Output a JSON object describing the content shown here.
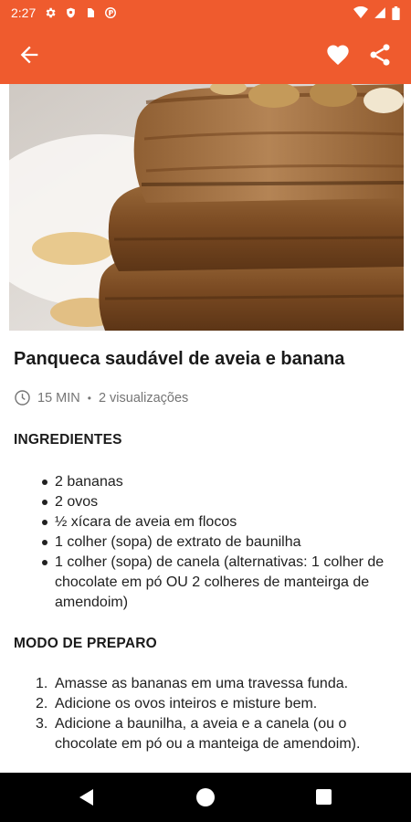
{
  "status_bar": {
    "time": "2:27",
    "icons": [
      "gear-icon",
      "shield-icon",
      "sim-card-icon",
      "sync-icon",
      "wifi-icon",
      "signal-icon",
      "battery-icon"
    ]
  },
  "app_bar": {
    "color": "#ef5b2e",
    "icons": [
      "arrow-back-icon",
      "heart-icon",
      "share-icon"
    ]
  },
  "hero_image": {
    "icon": "pancake-stack-photo"
  },
  "recipe": {
    "title": "Panqueca saudável de aveia e banana",
    "time": "15 MIN",
    "views": "2 visualizações"
  },
  "ingredients": {
    "heading": "INGREDIENTES",
    "items": [
      "2 bananas",
      "2 ovos",
      "½ xícara de aveia em flocos",
      "1 colher (sopa) de extrato de baunilha",
      "1 colher (sopa) de canela (alternativas: 1 colher de chocolate em pó OU 2 colheres de manteirga de amendoim)"
    ]
  },
  "preparation": {
    "heading": "MODO DE PREPARO",
    "steps": [
      {
        "number": "1.",
        "text": "Amasse as bananas em uma travessa funda."
      },
      {
        "number": "2.",
        "text": "Adicione os ovos inteiros e misture bem."
      },
      {
        "number": "3.",
        "text": "Adicione a baunilha, a aveia e a canela (ou o chocolate em pó ou a manteiga de amendoim)."
      }
    ]
  },
  "nav_bar": {
    "icons": [
      "nav-back-icon",
      "nav-home-icon",
      "nav-recent-icon"
    ]
  }
}
